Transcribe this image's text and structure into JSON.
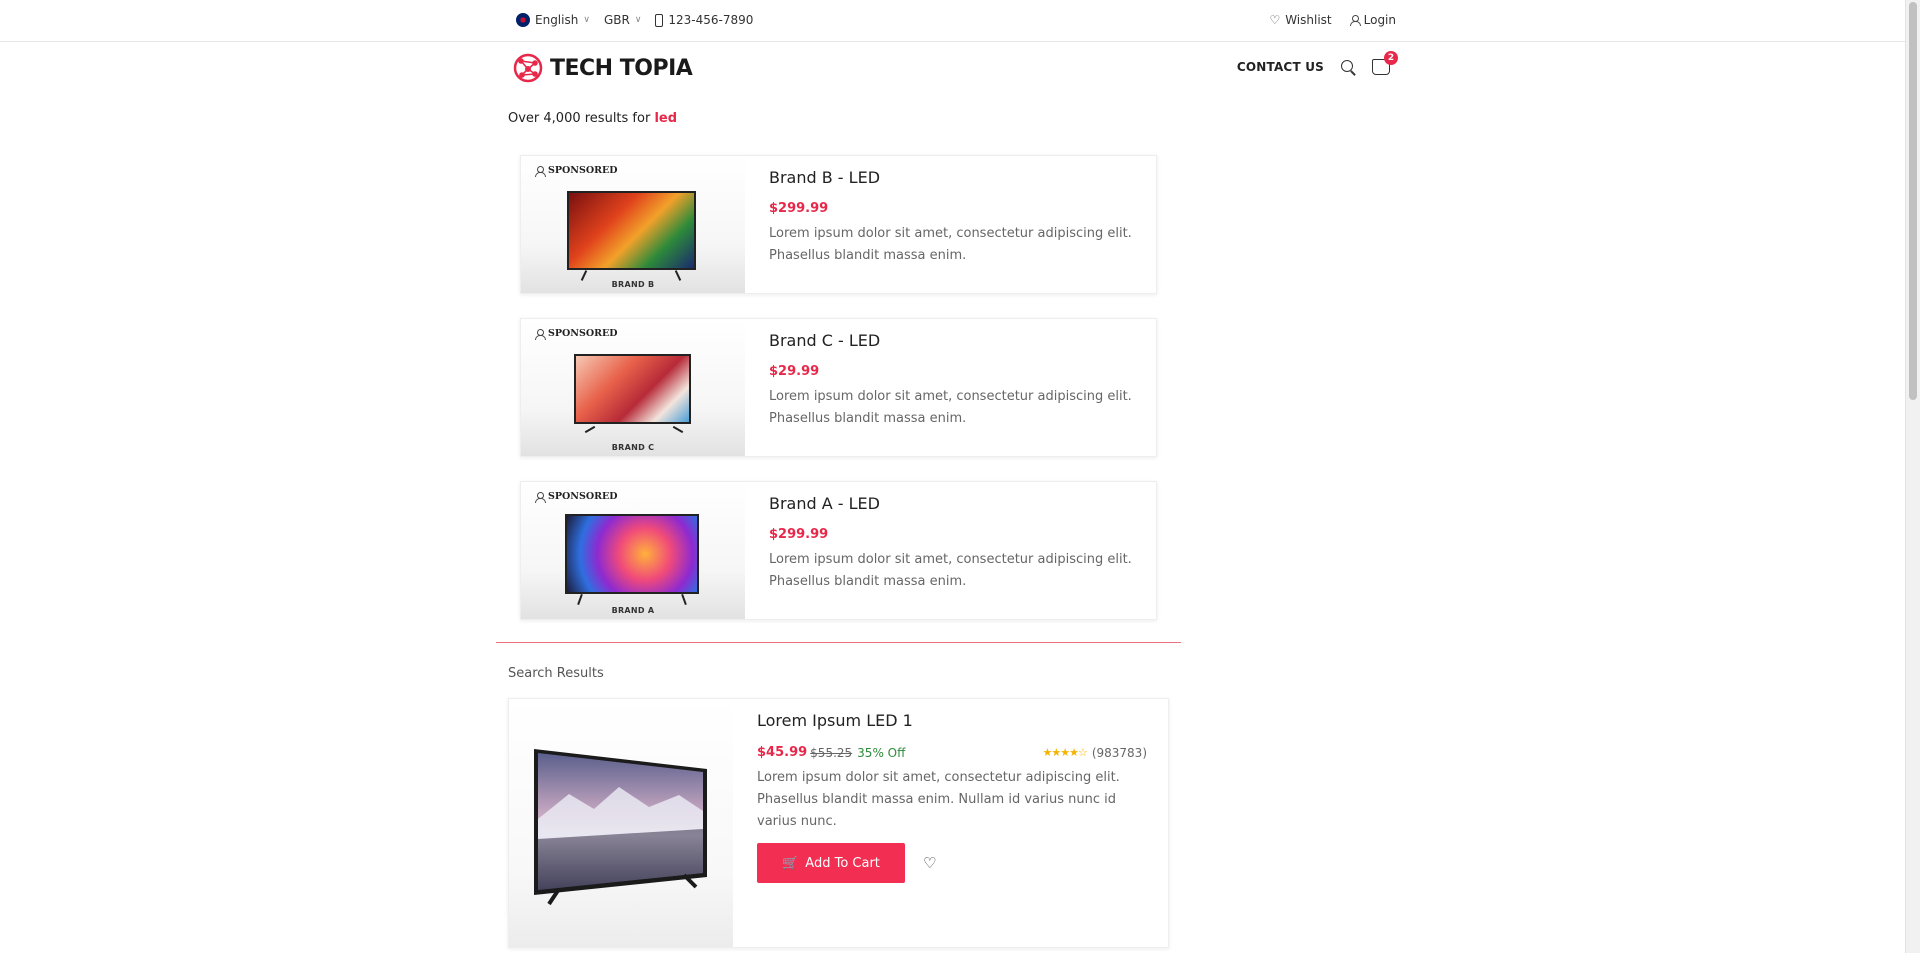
{
  "topbar": {
    "language": "English",
    "currency": "GBR",
    "phone": "123-456-7890",
    "wishlist": "Wishlist",
    "login": "Login"
  },
  "header": {
    "logo": "TECH TOPIA",
    "contact": "CONTACT US",
    "cart_count": "2"
  },
  "results": {
    "prefix": "Over 4,000 results for",
    "query": "led"
  },
  "sponsored": [
    {
      "tag": "SPONSORED",
      "brand": "BRAND B",
      "title": "Brand B - LED",
      "price": "$299.99",
      "desc": "Lorem ipsum dolor sit amet, consectetur adipiscing elit. Phasellus blandit massa enim."
    },
    {
      "tag": "SPONSORED",
      "brand": "BRAND C",
      "title": "Brand C - LED",
      "price": "$29.99",
      "desc": "Lorem ipsum dolor sit amet, consectetur adipiscing elit. Phasellus blandit massa enim."
    },
    {
      "tag": "SPONSORED",
      "brand": "BRAND A",
      "title": "Brand A - LED",
      "price": "$299.99",
      "desc": "Lorem ipsum dolor sit amet, consectetur adipiscing elit. Phasellus blandit massa enim."
    }
  ],
  "search_results_label": "Search Results",
  "product": {
    "title": "Lorem Ipsum LED 1",
    "price": "$45.99",
    "old_price": "$55.25",
    "discount": "35% Off",
    "rating": 4.5,
    "reviews": "(983783)",
    "desc": "Lorem ipsum dolor sit amet, consectetur adipiscing elit. Phasellus blandit massa enim. Nullam id varius nunc id varius nunc.",
    "add_to_cart": "Add To Cart"
  },
  "colors": {
    "accent": "#e7284a",
    "discount": "#2e8b3a",
    "star": "#f5b301"
  }
}
